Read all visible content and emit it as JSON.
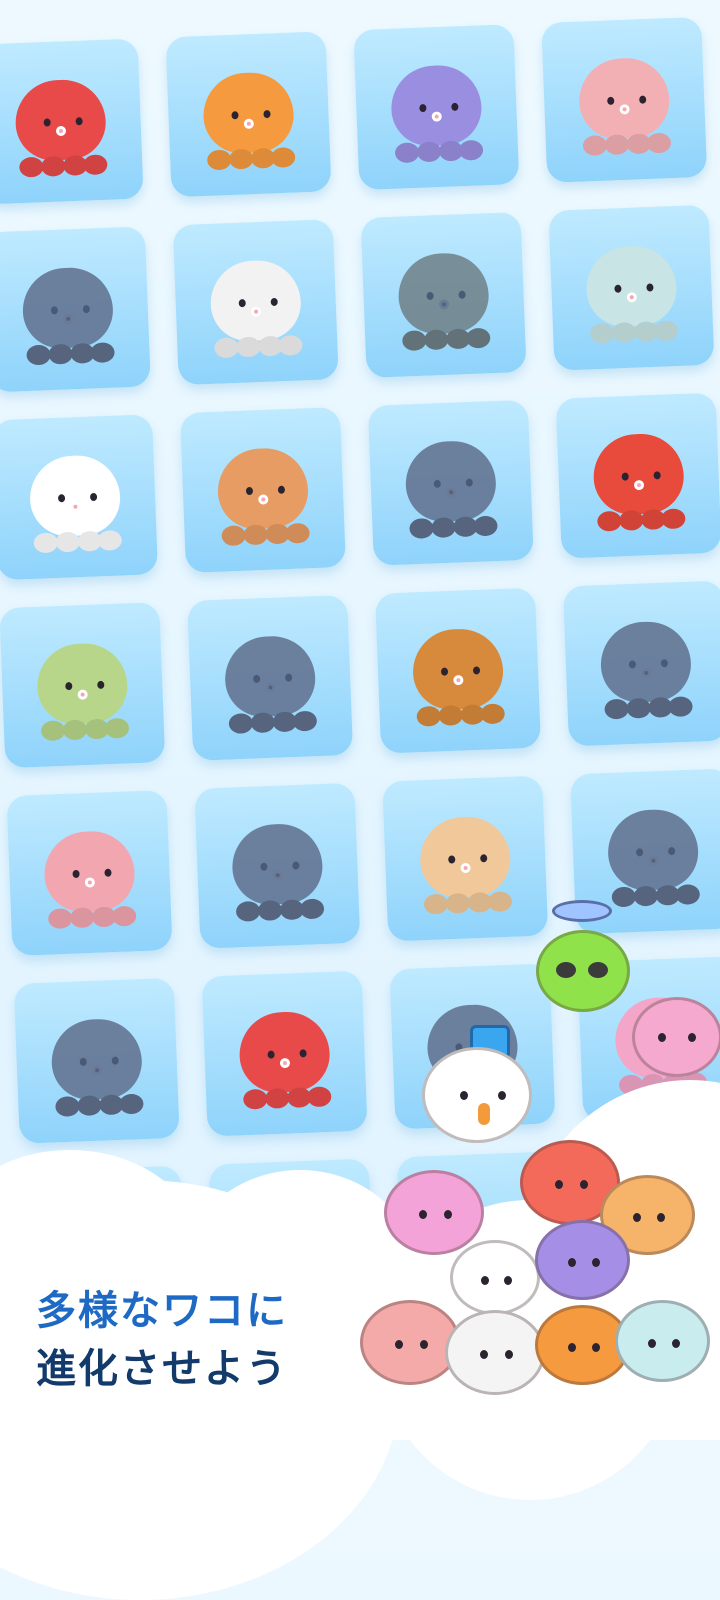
{
  "caption": {
    "line1": "多様なワコに",
    "line2": "進化させよう"
  },
  "characters": [
    {
      "name": "coconut-octopus",
      "color": "#e84a4a",
      "unlocked": true
    },
    {
      "name": "orange-octopus",
      "color": "#f59a3e",
      "unlocked": true
    },
    {
      "name": "gentleman-octopus",
      "color": "#9a8ee0",
      "unlocked": true
    },
    {
      "name": "headphone-octopus",
      "color": "#f3b0b4",
      "unlocked": true
    },
    {
      "name": "cherry-bomb-octopus",
      "color": "#5f6f8c",
      "unlocked": false
    },
    {
      "name": "sushi-octopus",
      "color": "#f2f2f2",
      "unlocked": true
    },
    {
      "name": "alien-octopus",
      "color": "#6e7f86",
      "unlocked": false
    },
    {
      "name": "ice-cream-octopus",
      "color": "#c8e4e4",
      "unlocked": true
    },
    {
      "name": "chicken-octopus",
      "color": "#ffffff",
      "unlocked": true
    },
    {
      "name": "pancake-octopus",
      "color": "#e69c62",
      "unlocked": true
    },
    {
      "name": "bucket-octopus",
      "color": "#5f6f8c",
      "unlocked": false
    },
    {
      "name": "apple-octopus",
      "color": "#e84a3c",
      "unlocked": true
    },
    {
      "name": "avocado-octopus",
      "color": "#b8d68a",
      "unlocked": true
    },
    {
      "name": "bear-octopus",
      "color": "#5f6f8c",
      "unlocked": false
    },
    {
      "name": "burger-octopus",
      "color": "#d78a3c",
      "unlocked": true
    },
    {
      "name": "castle-octopus",
      "color": "#5f6f8c",
      "unlocked": false
    },
    {
      "name": "rabbit-octopus",
      "color": "#f2a6b0",
      "unlocked": true
    },
    {
      "name": "panda-octopus",
      "color": "#5f6f8c",
      "unlocked": false
    },
    {
      "name": "pudding-octopus",
      "color": "#f0c89a",
      "unlocked": true
    },
    {
      "name": "penguin-octopus",
      "color": "#5f6f8c",
      "unlocked": false
    },
    {
      "name": "tiger-octopus",
      "color": "#5f6f8c",
      "unlocked": false
    },
    {
      "name": "king-octopus",
      "color": "#e84a4a",
      "unlocked": true
    },
    {
      "name": "locked-top-hat-octopus",
      "color": "#5f6f8c",
      "unlocked": false
    },
    {
      "name": "peach-octopus",
      "color": "#f3a6c8",
      "unlocked": true
    }
  ]
}
